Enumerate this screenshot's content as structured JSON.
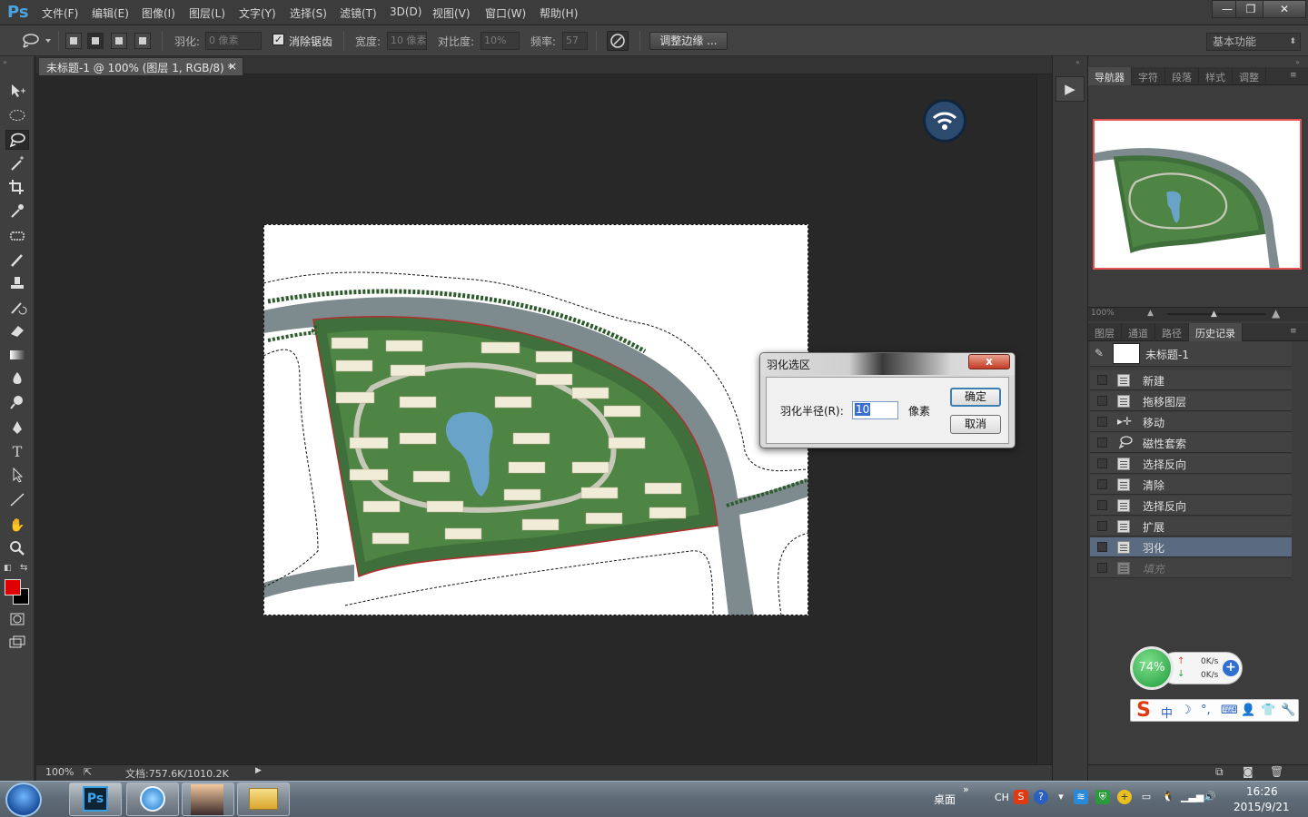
{
  "app": {
    "logo": "Ps",
    "accent": "#4aa3df"
  },
  "menu": [
    "文件(F)",
    "编辑(E)",
    "图像(I)",
    "图层(L)",
    "文字(Y)",
    "选择(S)",
    "滤镜(T)",
    "3D(D)",
    "视图(V)",
    "窗口(W)",
    "帮助(H)"
  ],
  "window_controls": {
    "minimize": "—",
    "restore": "❐",
    "close": "✕"
  },
  "options": {
    "feather_label": "羽化:",
    "feather_value": "0 像素",
    "antialias_label": "消除锯齿",
    "antialias_checked": true,
    "width_label": "宽度:",
    "width_value": "10 像素",
    "contrast_label": "对比度:",
    "contrast_value": "10%",
    "frequency_label": "频率:",
    "frequency_value": "57",
    "refine_button": "调整边缘 ...",
    "workspace": "基本功能"
  },
  "document": {
    "tab_title": "未标题-1 @ 100% (图层 1, RGB/8) *",
    "tab_close": "×",
    "zoom": "100%",
    "doc_size": "文档:757.6K/1010.2K"
  },
  "tools": [
    "move-icon",
    "marquee-icon",
    "magnetic-lasso-icon",
    "magic-wand-icon",
    "crop-icon",
    "eyedropper-icon",
    "healing-icon",
    "brush-icon",
    "stamp-icon",
    "history-brush-icon",
    "eraser-icon",
    "gradient-icon",
    "blur-icon",
    "dodge-icon",
    "pen-icon",
    "type-icon",
    "path-select-icon",
    "line-icon",
    "hand-icon",
    "zoom-icon"
  ],
  "colors": {
    "foreground": "#e00000",
    "background": "#000000"
  },
  "navigator_tabs": [
    "导航器",
    "字符",
    "段落",
    "样式",
    "调整"
  ],
  "navigator_zoom": "100%",
  "history_tabs": [
    "图层",
    "通道",
    "路径",
    "历史记录"
  ],
  "history": {
    "snapshot": "未标题-1",
    "items": [
      {
        "label": "新建",
        "icon": "document-icon"
      },
      {
        "label": "拖移图层",
        "icon": "document-icon"
      },
      {
        "label": "移动",
        "icon": "move-icon"
      },
      {
        "label": "磁性套索",
        "icon": "magnetic-lasso-icon"
      },
      {
        "label": "选择反向",
        "icon": "document-icon"
      },
      {
        "label": "清除",
        "icon": "document-icon"
      },
      {
        "label": "选择反向",
        "icon": "document-icon"
      },
      {
        "label": "扩展",
        "icon": "document-icon"
      },
      {
        "label": "羽化",
        "icon": "document-icon",
        "selected": true
      },
      {
        "label": "填充",
        "icon": "document-icon",
        "dimmed": true
      }
    ]
  },
  "dialog": {
    "title": "羽化选区",
    "close": "x",
    "radius_label": "羽化半径(R):",
    "radius_value": "10",
    "unit": "像素",
    "ok": "确定",
    "cancel": "取消"
  },
  "netmeter": {
    "percent": "74%",
    "up": "0K/s",
    "down": "0K/s"
  },
  "ime": {
    "logo": "S",
    "mode": "中"
  },
  "taskbar": {
    "desktop_label": "桌面",
    "lang": "CH",
    "time": "16:26",
    "date": "2015/9/21"
  }
}
